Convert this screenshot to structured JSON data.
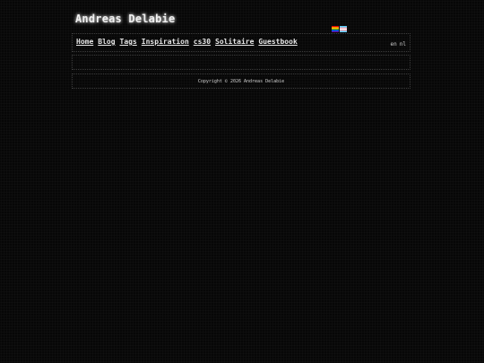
{
  "site": {
    "title": "Andreas Delabie"
  },
  "flags": [
    {
      "icon": "pride-flag-icon"
    },
    {
      "icon": "trans-flag-icon"
    }
  ],
  "nav": {
    "items": [
      {
        "label": "Home"
      },
      {
        "label": "Blog"
      },
      {
        "label": "Tags"
      },
      {
        "label": "Inspiration"
      },
      {
        "label": "cs30"
      },
      {
        "label": "Solitaire"
      },
      {
        "label": "Guestbook"
      }
    ]
  },
  "languages": [
    {
      "label": "en"
    },
    {
      "label": "nl"
    }
  ],
  "footer": {
    "copyright": "Copyright © 2026 Andreas Delabie"
  },
  "colors": {
    "background": "#070707",
    "text": "#e6e6e6",
    "border": "#3c3c3c"
  }
}
